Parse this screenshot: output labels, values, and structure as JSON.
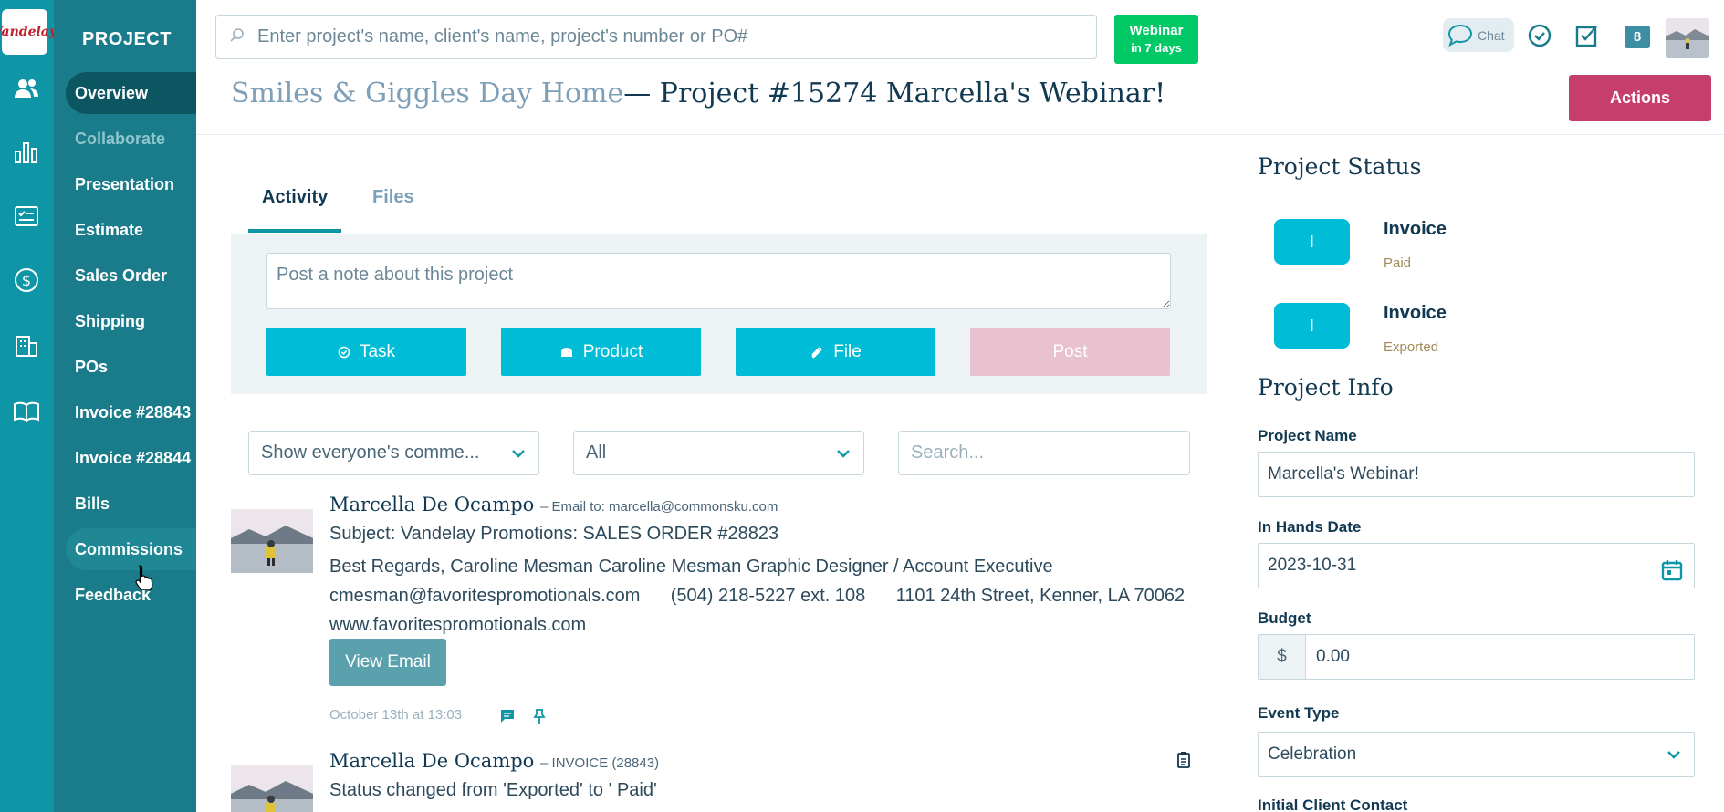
{
  "app": {
    "logo_text": "Vandelay",
    "section_title": "PROJECT"
  },
  "rail": {
    "icons": [
      "users-icon",
      "bar-chart-icon",
      "checklist-icon",
      "dollar-icon",
      "building-icon",
      "book-icon"
    ]
  },
  "nav": {
    "items": [
      {
        "label": "Overview",
        "state": "active"
      },
      {
        "label": "Collaborate",
        "state": "muted"
      },
      {
        "label": "Presentation",
        "state": "normal"
      },
      {
        "label": "Estimate",
        "state": "normal"
      },
      {
        "label": "Sales Order",
        "state": "normal"
      },
      {
        "label": "Shipping",
        "state": "normal"
      },
      {
        "label": "POs",
        "state": "normal"
      },
      {
        "label": "Invoice #28843",
        "state": "normal"
      },
      {
        "label": "Invoice #28844",
        "state": "normal"
      },
      {
        "label": "Bills",
        "state": "normal"
      },
      {
        "label": "Commissions",
        "state": "hover"
      },
      {
        "label": "Feedback",
        "state": "normal"
      }
    ]
  },
  "header": {
    "search_placeholder": "Enter project's name, client's name, project's number or PO#",
    "webinar_line1": "Webinar",
    "webinar_line2": "in 7 days",
    "chat_label": "Chat",
    "badge_count": "8",
    "client_name": "Smiles & Giggles Day Home",
    "project_title": "— Project #15274 Marcella's Webinar!",
    "actions_label": "Actions"
  },
  "tabs": [
    {
      "label": "Activity",
      "active": true
    },
    {
      "label": "Files",
      "active": false
    }
  ],
  "composer": {
    "placeholder": "Post a note about this project",
    "task_label": "Task",
    "product_label": "Product",
    "file_label": "File",
    "post_label": "Post"
  },
  "filters": {
    "people": "Show everyone's comme...",
    "type": "All",
    "search_placeholder": "Search..."
  },
  "feed": [
    {
      "author": "Marcella De Ocampo",
      "meta": "– Email to: marcella@commonsku.com",
      "subject": "Subject: Vandelay Promotions: SALES ORDER #28823",
      "line1": "Best Regards, Caroline Mesman Caroline Mesman Graphic Designer / Account Executive",
      "line2": "cmesman@favoritespromotionals.com      (504) 218-5227 ext. 108      1101 24th Street, Kenner, LA 70062",
      "line3": "www.favoritespromotionals.com",
      "button": "View Email",
      "timestamp": "October 13th at 13:03"
    },
    {
      "author": "Marcella De Ocampo",
      "meta": "– INVOICE (28843)",
      "line1": "Status changed from 'Exported' to ' Paid'"
    }
  ],
  "project_status": {
    "heading": "Project Status",
    "items": [
      {
        "box": "I",
        "title": "Invoice",
        "sub": "Paid"
      },
      {
        "box": "I",
        "title": "Invoice",
        "sub": "Exported"
      }
    ]
  },
  "project_info": {
    "heading": "Project Info",
    "project_name_label": "Project Name",
    "project_name": "Marcella's Webinar!",
    "in_hands_label": "In Hands Date",
    "in_hands": "2023-10-31",
    "budget_label": "Budget",
    "currency": "$",
    "budget": "0.00",
    "event_type_label": "Event Type",
    "event_type": "Celebration",
    "contact_label": "Initial Client Contact"
  },
  "colors": {
    "rail": "#0f96a6",
    "nav": "#1a7c8a",
    "accent": "#00bcd6",
    "actions": "#c53e6c",
    "webinar": "#00c865"
  }
}
